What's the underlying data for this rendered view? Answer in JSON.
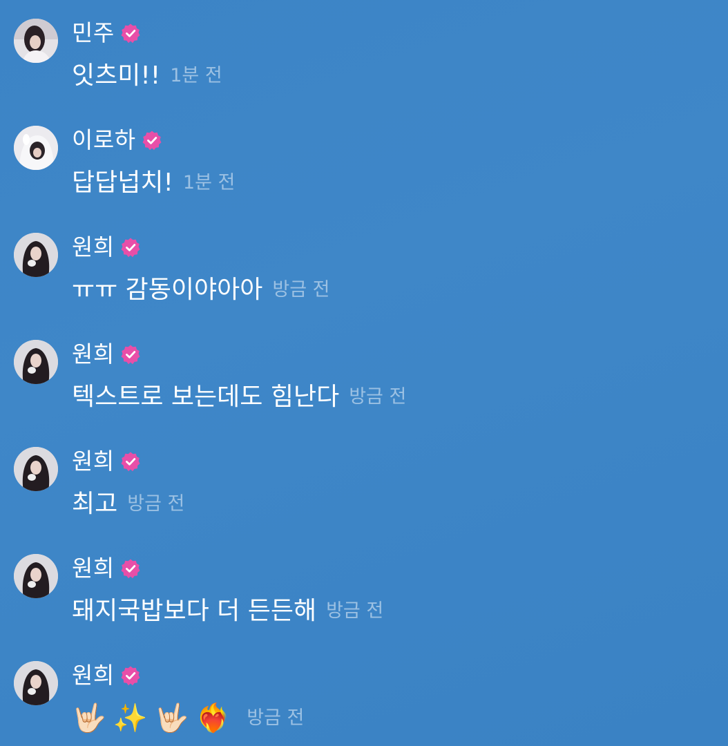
{
  "colors": {
    "background": "#3d85c6",
    "timestamp": "#9cc1e3",
    "verified_badge": "#e84fa8"
  },
  "messages": [
    {
      "user": "민주",
      "avatar": "avatar-minju",
      "text": "잇츠미!!",
      "time": "1분 전"
    },
    {
      "user": "이로하",
      "avatar": "avatar-iroha",
      "text": "답답넙치!",
      "time": "1분 전"
    },
    {
      "user": "원희",
      "avatar": "avatar-wonhee",
      "text": "ㅠㅠ 감동이야아아",
      "time": "방금 전"
    },
    {
      "user": "원희",
      "avatar": "avatar-wonhee",
      "text": "텍스트로 보는데도 힘난다",
      "time": "방금 전"
    },
    {
      "user": "원희",
      "avatar": "avatar-wonhee",
      "text": "최고",
      "time": "방금 전"
    },
    {
      "user": "원희",
      "avatar": "avatar-wonhee",
      "text": "돼지국밥보다 더 든든해",
      "time": "방금 전"
    },
    {
      "user": "원희",
      "avatar": "avatar-wonhee",
      "emojis": [
        "🤟🏻",
        "✨",
        "🤟🏻",
        "❤️‍🔥"
      ],
      "time": "방금 전"
    }
  ]
}
